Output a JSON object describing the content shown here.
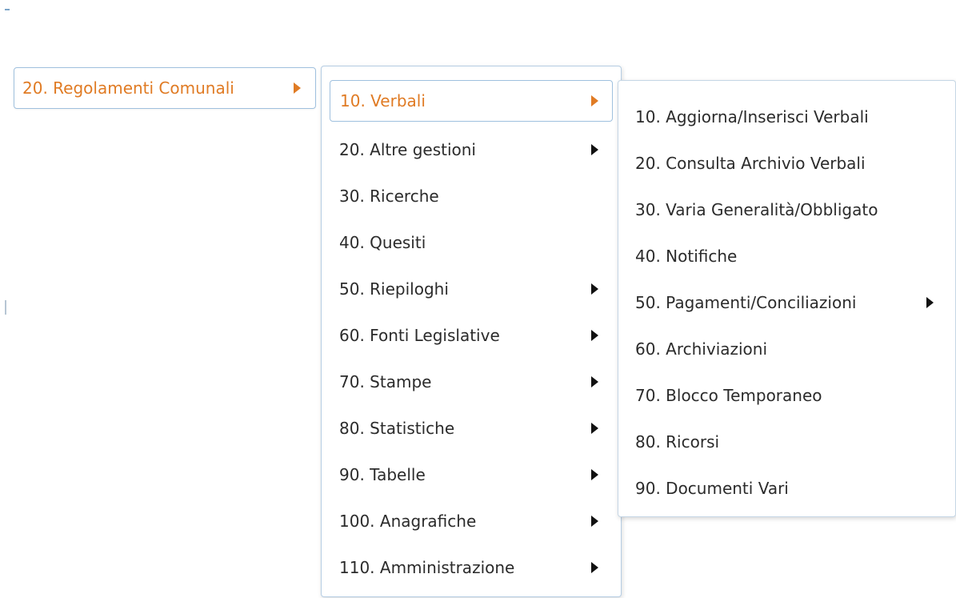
{
  "root": {
    "label": "20. Regolamenti Comunali",
    "has_submenu": true,
    "accent_color": "#e07b24"
  },
  "submenu": {
    "items": [
      {
        "label": "10. Verbali",
        "has_submenu": true,
        "active": true
      },
      {
        "label": "20. Altre gestioni",
        "has_submenu": true
      },
      {
        "label": "30. Ricerche",
        "has_submenu": false
      },
      {
        "label": "40. Quesiti",
        "has_submenu": false
      },
      {
        "label": "50. Riepiloghi",
        "has_submenu": true
      },
      {
        "label": "60. Fonti Legislative",
        "has_submenu": true
      },
      {
        "label": "70. Stampe",
        "has_submenu": true
      },
      {
        "label": "80. Statistiche",
        "has_submenu": true
      },
      {
        "label": "90. Tabelle",
        "has_submenu": true
      },
      {
        "label": "100. Anagrafiche",
        "has_submenu": true
      },
      {
        "label": "110. Amministrazione",
        "has_submenu": true
      }
    ]
  },
  "subsubmenu": {
    "items": [
      {
        "label": "10. Aggiorna/Inserisci Verbali",
        "has_submenu": false
      },
      {
        "label": "20. Consulta Archivio Verbali",
        "has_submenu": false
      },
      {
        "label": "30. Varia Generalità/Obbligato",
        "has_submenu": false
      },
      {
        "label": "40. Notifiche",
        "has_submenu": false
      },
      {
        "label": "50. Pagamenti/Conciliazioni",
        "has_submenu": true
      },
      {
        "label": "60. Archiviazioni",
        "has_submenu": false
      },
      {
        "label": "70. Blocco Temporaneo",
        "has_submenu": false
      },
      {
        "label": "80. Ricorsi",
        "has_submenu": false
      },
      {
        "label": "90. Documenti Vari",
        "has_submenu": false
      }
    ]
  }
}
